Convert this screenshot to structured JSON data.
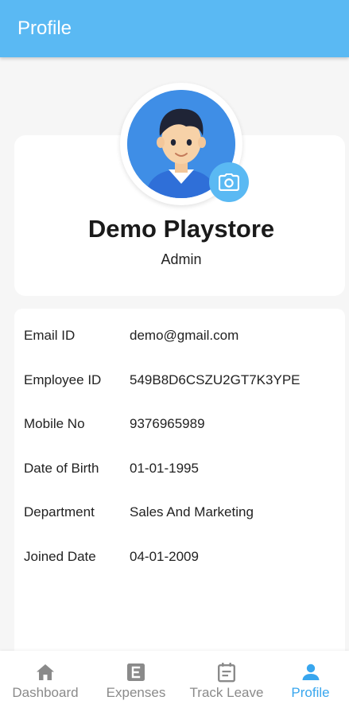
{
  "appbar": {
    "title": "Profile"
  },
  "profile": {
    "name": "Demo Playstore",
    "role": "Admin"
  },
  "details": [
    {
      "label": "Email ID",
      "value": "demo@gmail.com"
    },
    {
      "label": "Employee ID",
      "value": "549B8D6CSZU2GT7K3YPE"
    },
    {
      "label": "Mobile No",
      "value": "9376965989"
    },
    {
      "label": "Date of Birth",
      "value": "01-01-1995"
    },
    {
      "label": "Department",
      "value": "Sales And Marketing"
    },
    {
      "label": "Joined Date",
      "value": "04-01-2009"
    }
  ],
  "nav": {
    "items": [
      {
        "label": "Dashboard",
        "icon": "home-icon"
      },
      {
        "label": "Expenses",
        "icon": "expenses-icon"
      },
      {
        "label": "Track Leave",
        "icon": "calendar-icon"
      },
      {
        "label": "Profile",
        "icon": "person-icon",
        "active": true
      }
    ]
  },
  "colors": {
    "primary": "#5ab9f3",
    "active_nav": "#38a6ee",
    "inactive_nav": "#8a8a8a",
    "background": "#f6f6f6"
  }
}
